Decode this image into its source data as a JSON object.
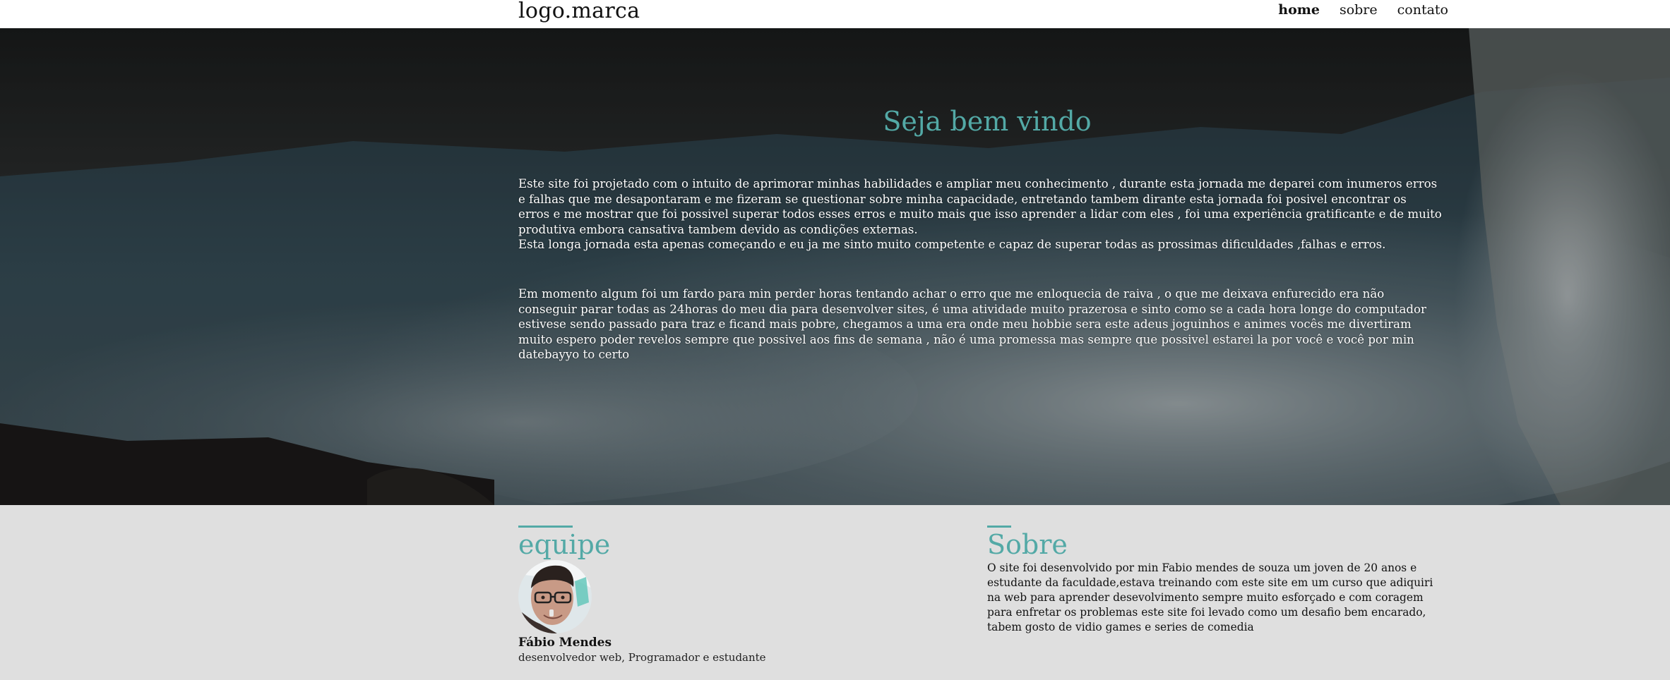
{
  "header": {
    "logo": "logo.marca",
    "nav": [
      {
        "label": "home",
        "active": true
      },
      {
        "label": "sobre",
        "active": false
      },
      {
        "label": "contato",
        "active": false
      }
    ]
  },
  "hero": {
    "title": "Seja bem vindo",
    "paragraph1_lines": [
      "Este site foi projetado com o intuito de aprimorar minhas habilidades e ampliar meu conhecimento , durante esta jornada me deparei com inumeros erros",
      "e falhas que me desapontaram e me fizeram se questionar sobre minha capacidade, entretando tambem dirante esta jornada foi posivel encontrar os",
      "erros e me mostrar que foi possivel superar todos esses erros e muito mais que isso aprender a lidar com eles , foi uma experiência gratificante e de muito",
      "produtiva embora cansativa tambem devido as condições externas.",
      "Esta longa jornada esta apenas começando e eu ja me sinto muito competente e capaz de superar todas as prossimas dificuldades ,falhas e erros."
    ],
    "paragraph2_lines": [
      "Em momento algum foi um fardo para min perder horas tentando achar o erro que me enloquecia de raiva , o que me deixava enfurecido era não",
      "conseguir parar todas as 24horas do meu dia para desenvolver sites, é uma atividade muito prazerosa e sinto como se a cada hora longe do computador",
      "estivese sendo passado para traz e ficand mais pobre, chegamos a uma era onde meu hobbie sera este adeus joguinhos e animes vocês me divertiram",
      "muito espero poder revelos sempre que possivel aos fins de semana , não é uma promessa mas sempre que possivel estarei la por você e você por min",
      "datebayyo to certo"
    ]
  },
  "equipe": {
    "title": "equipe",
    "member_name": "Fábio Mendes",
    "member_role": "desenvolvedor web, Programador e estudante"
  },
  "sobre": {
    "title": "Sobre",
    "lines": [
      "O site foi desenvolvido por min Fabio mendes de souza um joven de 20 anos e",
      "estudante da faculdade,estava treinando com este site em um curso que adiquiri",
      "na web para aprender desevolvimento sempre muito esforçado e com coragem",
      "para enfretar os problemas este site foi levado como um desafio bem encarado,",
      "tabem gosto de vidio games e series de comedia"
    ]
  },
  "colors": {
    "accent": "#53a9a6",
    "header_bg": "#ffffff",
    "footer_bg": "#dfdfdf"
  }
}
